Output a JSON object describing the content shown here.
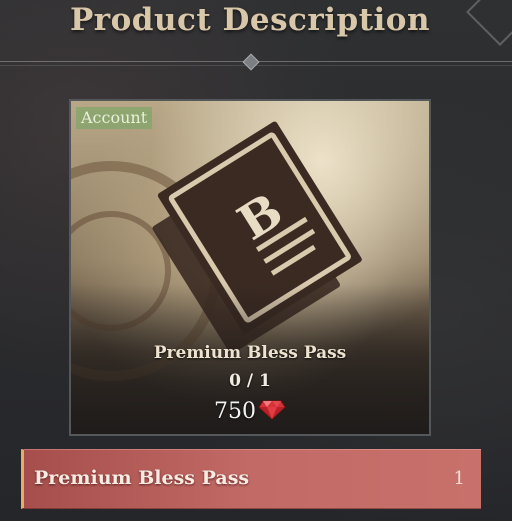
{
  "header": {
    "title": "Product Description"
  },
  "product_card": {
    "badge": "Account",
    "name": "Premium Bless Pass",
    "owned_count": "0 / 1",
    "price": "750",
    "currency_icon": "red-gem-icon",
    "emblem_letter": "B"
  },
  "item_list": [
    {
      "label": "Premium Bless Pass",
      "quantity": "1"
    }
  ],
  "colors": {
    "title": "#d8c7a9",
    "badge_bg": "#82a569",
    "selected_row": "#c26a66",
    "selected_accent": "#e0b165",
    "gem": "#d8313a"
  }
}
